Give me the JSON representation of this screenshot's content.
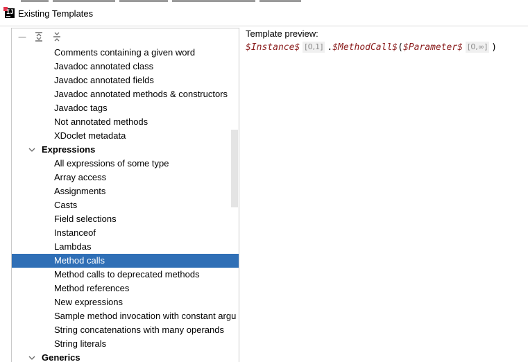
{
  "window": {
    "title": "Existing Templates",
    "icon": "intellij-app-icon"
  },
  "toolbar": {
    "buttons": [
      {
        "name": "collapse-icon",
        "glyph": "—"
      },
      {
        "name": "expand-all-icon",
        "glyph": "⇤"
      },
      {
        "name": "collapse-all-icon",
        "glyph": "⇥"
      }
    ]
  },
  "tree": {
    "items": [
      {
        "type": "child",
        "label": "Comments containing a given word"
      },
      {
        "type": "child",
        "label": "Javadoc annotated class"
      },
      {
        "type": "child",
        "label": "Javadoc annotated fields"
      },
      {
        "type": "child",
        "label": "Javadoc annotated methods & constructors"
      },
      {
        "type": "child",
        "label": "Javadoc tags"
      },
      {
        "type": "child",
        "label": "Not annotated methods"
      },
      {
        "type": "child",
        "label": "XDoclet metadata"
      },
      {
        "type": "group",
        "label": "Expressions",
        "expanded": true
      },
      {
        "type": "child",
        "label": "All expressions of some type"
      },
      {
        "type": "child",
        "label": "Array access"
      },
      {
        "type": "child",
        "label": "Assignments"
      },
      {
        "type": "child",
        "label": "Casts"
      },
      {
        "type": "child",
        "label": "Field selections"
      },
      {
        "type": "child",
        "label": "Instanceof"
      },
      {
        "type": "child",
        "label": "Lambdas"
      },
      {
        "type": "child",
        "label": "Method calls",
        "selected": true
      },
      {
        "type": "child",
        "label": "Method calls to deprecated methods"
      },
      {
        "type": "child",
        "label": "Method references"
      },
      {
        "type": "child",
        "label": "New expressions"
      },
      {
        "type": "child",
        "label": "Sample method invocation with constant argu"
      },
      {
        "type": "child",
        "label": "String concatenations with many operands"
      },
      {
        "type": "child",
        "label": "String literals"
      },
      {
        "type": "group",
        "label": "Generics",
        "expanded": true
      }
    ]
  },
  "preview": {
    "label": "Template preview:",
    "instance_var": "$Instance$",
    "instance_count": "[0,1]",
    "dot": ".",
    "method_var": "$MethodCall$",
    "open_paren": "(",
    "param_var": "$Parameter$",
    "param_count": "[0,∞]",
    "close_paren": ")"
  },
  "colors": {
    "selection": "#2f6fb6",
    "variable": "#8a1c1c",
    "count_badge_bg": "#f0f0f0"
  }
}
